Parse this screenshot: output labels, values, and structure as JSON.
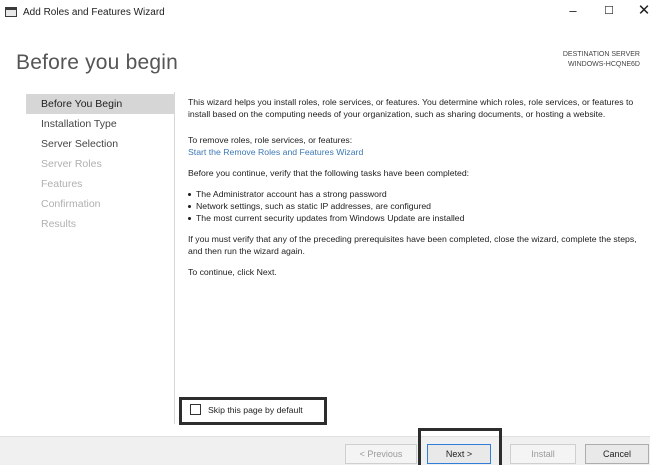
{
  "window": {
    "title": "Add Roles and Features Wizard",
    "minimize": "–",
    "maximize": "☐",
    "close": "✕"
  },
  "header": {
    "page_title": "Before you begin",
    "destination_label": "DESTINATION SERVER",
    "destination_server": "WINDOWS-HCQNE6D"
  },
  "nav": {
    "items": [
      {
        "label": "Before You Begin",
        "state": "selected"
      },
      {
        "label": "Installation Type",
        "state": "enabled"
      },
      {
        "label": "Server Selection",
        "state": "enabled"
      },
      {
        "label": "Server Roles",
        "state": "disabled"
      },
      {
        "label": "Features",
        "state": "disabled"
      },
      {
        "label": "Confirmation",
        "state": "disabled"
      },
      {
        "label": "Results",
        "state": "disabled"
      }
    ]
  },
  "content": {
    "intro": "This wizard helps you install roles, role services, or features. You determine which roles, role services, or features to install based on the computing needs of your organization, such as sharing documents, or hosting a website.",
    "remove_heading": "To remove roles, role services, or features:",
    "remove_link": "Start the Remove Roles and Features Wizard",
    "verify_text": "Before you continue, verify that the following tasks have been completed:",
    "bullets": [
      "The Administrator account has a strong password",
      "Network settings, such as static IP addresses, are configured",
      "The most current security updates from Windows Update are installed"
    ],
    "prereq_text": "If you must verify that any of the preceding prerequisites have been completed, close the wizard, complete the steps, and then run the wizard again.",
    "continue_text": "To continue, click Next."
  },
  "skip": {
    "label": "Skip this page by default",
    "checked": false
  },
  "footer": {
    "previous": "< Previous",
    "next": "Next >",
    "install": "Install",
    "cancel": "Cancel"
  },
  "colors": {
    "link": "#3c78b4",
    "selected_nav_bg": "#d6d6d6",
    "highlight_box": "#2d2d2d"
  }
}
